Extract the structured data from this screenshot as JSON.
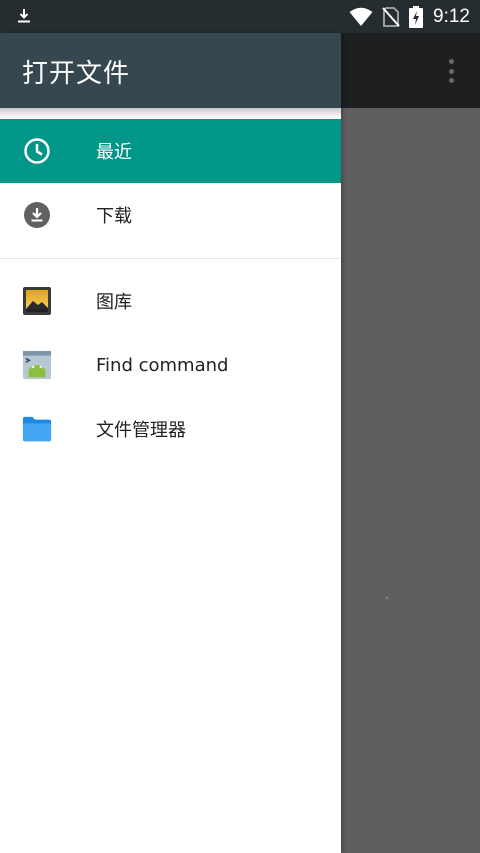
{
  "status_bar": {
    "time": "9:12",
    "icons": [
      "download-icon",
      "wifi-icon",
      "no-sim-icon",
      "battery-charging-icon"
    ]
  },
  "drawer": {
    "title": "打开文件",
    "roots": [
      {
        "label": "最近",
        "icon": "clock-icon",
        "active": true
      },
      {
        "label": "下载",
        "icon": "download-circle-icon",
        "active": false
      }
    ],
    "apps": [
      {
        "label": "图库",
        "icon": "gallery-icon"
      },
      {
        "label": "Find command",
        "icon": "android-app-icon"
      },
      {
        "label": "文件管理器",
        "icon": "folder-icon"
      }
    ]
  },
  "app_bar": {
    "overflow_icon": "more-vert-icon"
  },
  "colors": {
    "accent": "#009688",
    "header": "#37474f",
    "status_bar": "#262d30",
    "scrim": "#5f5f5f"
  }
}
